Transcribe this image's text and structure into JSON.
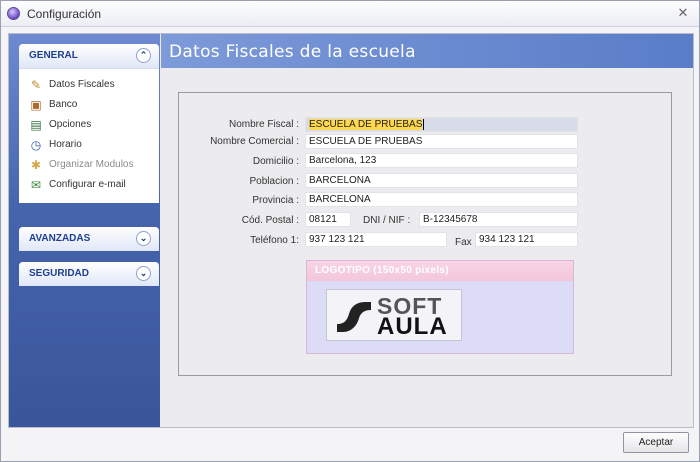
{
  "window": {
    "title": "Configuración"
  },
  "sidebar": {
    "panels": [
      {
        "title": "GENERAL",
        "expanded": true,
        "items": [
          {
            "label": "Datos Fiscales",
            "icon": "pen-icon",
            "enabled": true
          },
          {
            "label": "Banco",
            "icon": "bank-icon",
            "enabled": true
          },
          {
            "label": "Opciones",
            "icon": "options-icon",
            "enabled": true
          },
          {
            "label": "Horario",
            "icon": "clock-icon",
            "enabled": true
          },
          {
            "label": "Organizar Modulos",
            "icon": "modules-icon",
            "enabled": false
          },
          {
            "label": "Configurar e-mail",
            "icon": "email-icon",
            "enabled": true
          }
        ]
      },
      {
        "title": "AVANZADAS",
        "expanded": false
      },
      {
        "title": "SEGURIDAD",
        "expanded": false
      }
    ]
  },
  "main": {
    "title": "Datos Fiscales de la escuela",
    "form": {
      "nombre_fiscal": {
        "label": "Nombre Fiscal :",
        "value": "ESCUELA DE PRUEBAS"
      },
      "nombre_comercial": {
        "label": "Nombre Comercial :",
        "value": "ESCUELA DE PRUEBAS"
      },
      "domicilio": {
        "label": "Domicilio :",
        "value": "Barcelona, 123"
      },
      "poblacion": {
        "label": "Poblacion :",
        "value": "BARCELONA"
      },
      "provincia": {
        "label": "Provincia :",
        "value": "BARCELONA"
      },
      "cod_postal": {
        "label": "Cód. Postal :",
        "value": "08121"
      },
      "dni_nif": {
        "label": "DNI / NIF :",
        "value": "B-12345678"
      },
      "telefono1": {
        "label": "Teléfono 1:",
        "value": "937 123 121"
      },
      "fax": {
        "label": "Fax :",
        "value": "934 123 121"
      }
    },
    "logo": {
      "header": "LOGOTIPO  (150x50 pixels)",
      "line1": "SOFT",
      "line2": "AULA"
    }
  },
  "footer": {
    "accept_label": "Aceptar"
  },
  "colors": {
    "sidebar": "#4564ac",
    "header": "#6f8fd3",
    "highlight": "#ffd84d",
    "logo_header": "#f3c6dc"
  }
}
